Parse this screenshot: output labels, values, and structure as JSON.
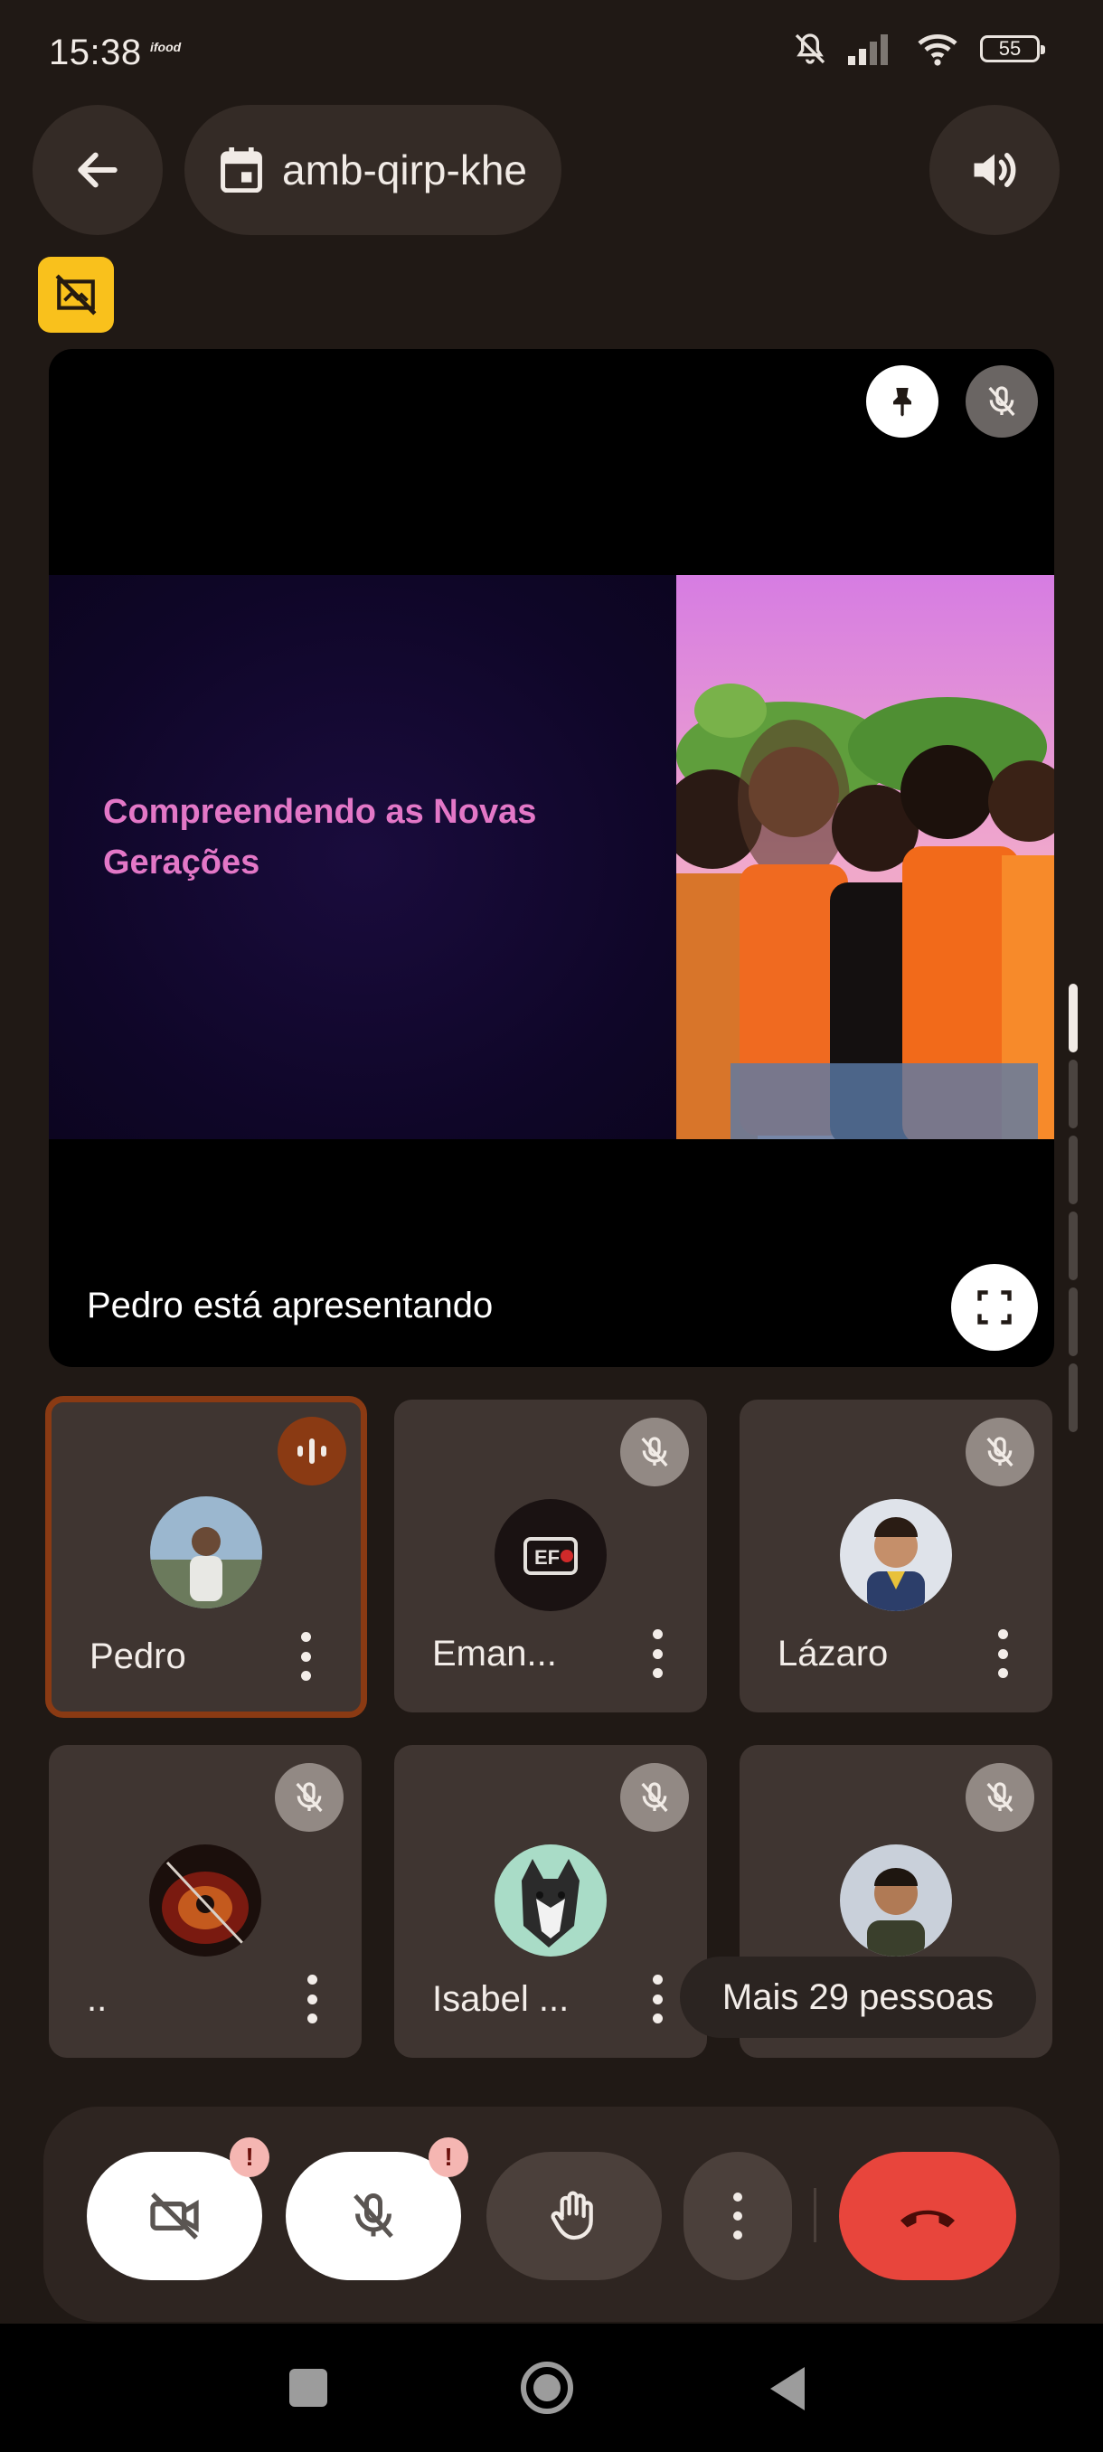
{
  "status_bar": {
    "time": "15:38",
    "app_tag": "ifood",
    "battery": "55"
  },
  "header": {
    "meeting_code": "amb-qirp-khe"
  },
  "presentation": {
    "slide_title": "Compreendendo as Novas Gerações",
    "presenter_text": "Pedro está apresentando"
  },
  "participants": [
    {
      "name": "Pedro",
      "speaking": true
    },
    {
      "name": "Eman...",
      "muted": true
    },
    {
      "name": "Lázaro",
      "muted": true
    },
    {
      "name": "..",
      "muted": true
    },
    {
      "name": "Isabel ...",
      "muted": true
    },
    {
      "name": "",
      "muted": true
    }
  ],
  "more_people": "Mais 29 pessoas",
  "controls": {
    "camera_alert": "!",
    "mic_alert": "!"
  },
  "colors": {
    "end_call": "#e8453c",
    "active_border": "#8a3a13",
    "badge_yellow": "#f9c11c"
  }
}
